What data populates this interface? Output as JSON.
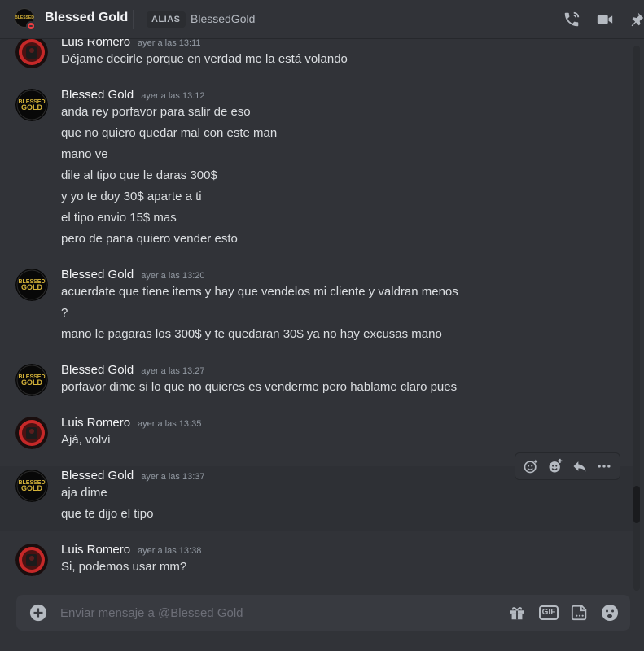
{
  "header": {
    "title": "Blessed Gold",
    "alias_label": "ALIAS",
    "alias_value": "BlessedGold"
  },
  "colors": {
    "background": "#313338",
    "composer": "#383a40",
    "dnd": "#f23f43",
    "gold": "#d6b43a",
    "luis_avatar_red": "#c62828"
  },
  "messages": [
    {
      "author": "Luis Romero",
      "timestamp": "ayer a las 13:11",
      "avatar": "luis",
      "lines": [
        "Déjame decirle porque en verdad me la está volando"
      ]
    },
    {
      "author": "Blessed Gold",
      "timestamp": "ayer a las 13:12",
      "avatar": "blessed",
      "lines": [
        "anda rey porfavor para salir de eso",
        "que no quiero quedar mal con este man",
        "mano ve",
        "dile al tipo que le daras 300$",
        "y yo te doy 30$ aparte a ti",
        "el tipo envio 15$ mas",
        "pero de pana quiero vender esto"
      ]
    },
    {
      "author": "Blessed Gold",
      "timestamp": "ayer a las 13:20",
      "avatar": "blessed",
      "lines": [
        "acuerdate que tiene items y hay que vendelos mi cliente y valdran menos",
        "?",
        "mano le pagaras los 300$ y te quedaran 30$ ya no hay excusas mano"
      ]
    },
    {
      "author": "Blessed Gold",
      "timestamp": "ayer a las 13:27",
      "avatar": "blessed",
      "lines": [
        "porfavor dime si lo que no quieres es venderme pero hablame claro pues"
      ]
    },
    {
      "author": "Luis Romero",
      "timestamp": "ayer a las 13:35",
      "avatar": "luis",
      "lines": [
        "Ajá, volví"
      ]
    },
    {
      "author": "Blessed Gold",
      "timestamp": "ayer a las 13:37",
      "avatar": "blessed",
      "lines": [
        "aja dime",
        "que te dijo el tipo"
      ]
    },
    {
      "author": "Luis Romero",
      "timestamp": "ayer a las 13:38",
      "avatar": "luis",
      "lines": [
        "Si, podemos usar mm?"
      ]
    }
  ],
  "avatar_text": {
    "blessed_line1": "BLESSED",
    "blessed_line2": "GOLD"
  },
  "message_toolbar": {
    "icons": [
      "add-super-reaction-icon",
      "add-reaction-icon",
      "reply-icon",
      "more-icon"
    ]
  },
  "composer": {
    "placeholder": "Enviar mensaje a @Blessed Gold",
    "gif_label": "GIF",
    "icons": [
      "add-icon",
      "gift-icon",
      "gif-icon",
      "sticker-icon",
      "emoji-icon"
    ]
  },
  "header_icons": [
    "call-icon",
    "video-icon",
    "pin-icon"
  ]
}
